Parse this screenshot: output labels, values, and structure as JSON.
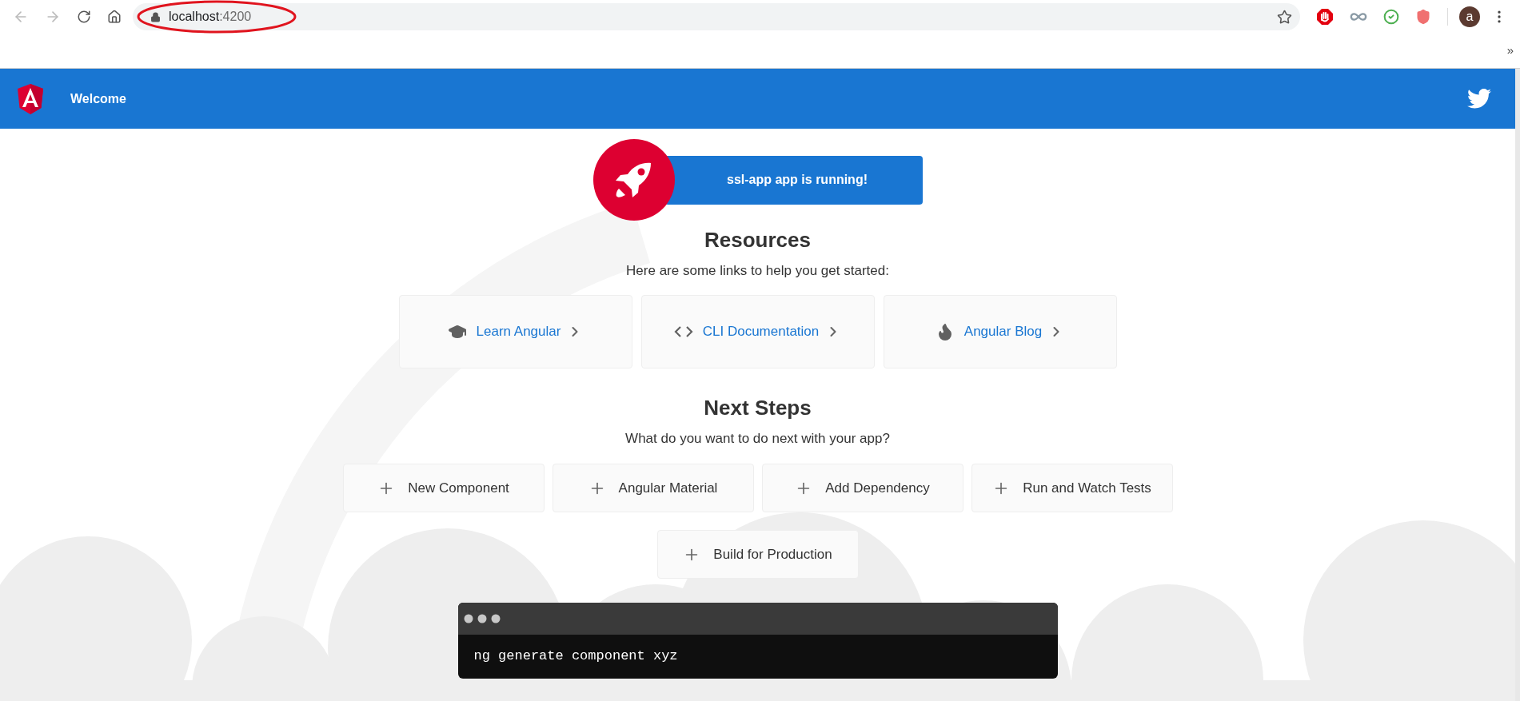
{
  "browser": {
    "url_host": "localhost",
    "url_port": ":4200",
    "avatar_letter": "a",
    "overflow": "»"
  },
  "header": {
    "title": "Welcome"
  },
  "banner": {
    "text": "ssl-app app is running!"
  },
  "resources": {
    "title": "Resources",
    "subtitle": "Here are some links to help you get started:",
    "links": [
      {
        "label": "Learn Angular",
        "kind": "learn"
      },
      {
        "label": "CLI Documentation",
        "kind": "cli"
      },
      {
        "label": "Angular Blog",
        "kind": "blog"
      }
    ]
  },
  "next_steps": {
    "title": "Next Steps",
    "subtitle": "What do you want to do next with your app?",
    "actions": [
      {
        "label": "New Component"
      },
      {
        "label": "Angular Material"
      },
      {
        "label": "Add Dependency"
      },
      {
        "label": "Run and Watch Tests"
      },
      {
        "label": "Build for Production"
      }
    ]
  },
  "terminal": {
    "command": "ng generate component xyz"
  }
}
